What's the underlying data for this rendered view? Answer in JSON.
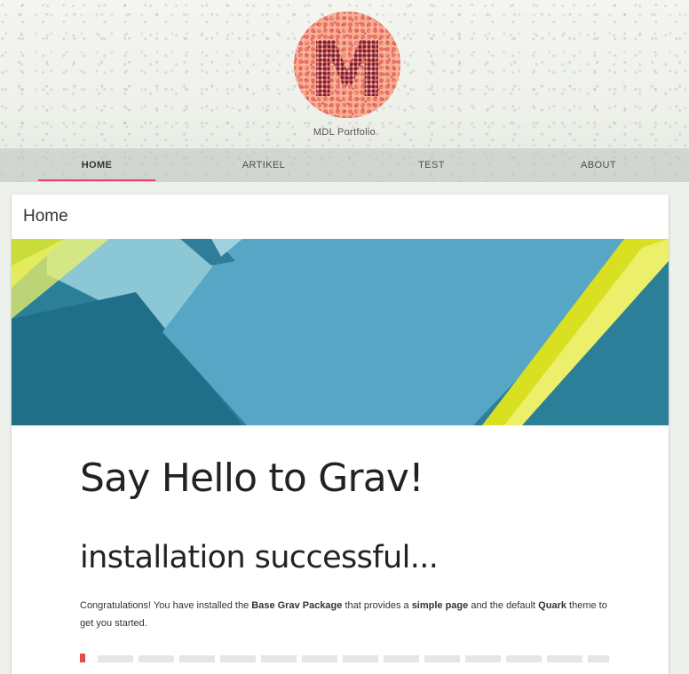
{
  "header": {
    "logo_letter": "M",
    "site_name": "MDL Portfolio"
  },
  "nav": {
    "items": [
      {
        "label": "HOME",
        "active": true
      },
      {
        "label": "ARTIKEL",
        "active": false
      },
      {
        "label": "TEST",
        "active": false
      },
      {
        "label": "ABOUT",
        "active": false
      }
    ]
  },
  "card": {
    "title": "Home"
  },
  "content": {
    "heading": "Say Hello to Grav!",
    "subheading": "installation successful...",
    "intro": {
      "t1": "Congratulations! You have installed the ",
      "b1": "Base Grav Package",
      "t2": " that provides a ",
      "b2": "simple page",
      "t3": " and the default ",
      "b3": "Quark",
      "t4": " theme to get you started."
    }
  },
  "colors": {
    "accent": "#e9407a",
    "quote_border": "#e14c4c",
    "hero_teal": "#2b7f99",
    "hero_yellow": "#d9e021"
  }
}
